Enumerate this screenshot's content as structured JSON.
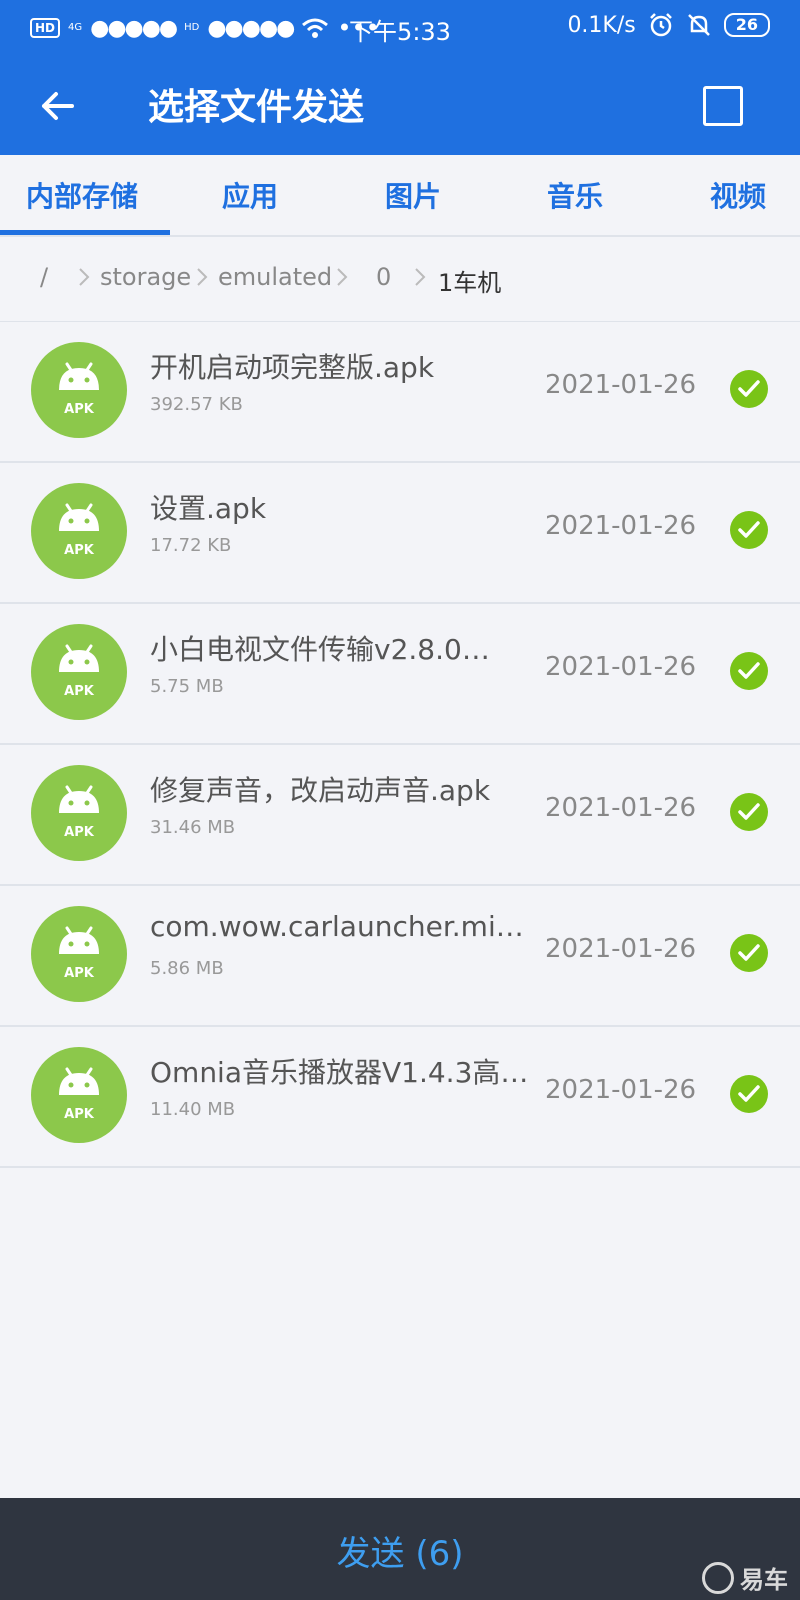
{
  "status_bar": {
    "hd1": "HD",
    "signal1": "4G",
    "dots1": "●●●●●",
    "hd2": "HD",
    "dots2": "●●●●●",
    "more": "•••",
    "time": "下午5:33",
    "net_speed": "0.1K/s",
    "battery": "26"
  },
  "appbar": {
    "title": "选择文件发送"
  },
  "tabs": [
    {
      "label": "内部存储",
      "active": true
    },
    {
      "label": "应用",
      "active": false
    },
    {
      "label": "图片",
      "active": false
    },
    {
      "label": "音乐",
      "active": false
    },
    {
      "label": "视频",
      "active": false
    }
  ],
  "breadcrumb": [
    "/",
    "storage",
    "emulated",
    "0",
    "1车机"
  ],
  "files": [
    {
      "name": "开机启动项完整版.apk",
      "size": "392.57 KB",
      "date": "2021-01-26",
      "icon_label": "APK"
    },
    {
      "name": "设置.apk",
      "size": "17.72 KB",
      "date": "2021-01-26",
      "icon_label": "APK"
    },
    {
      "name": "小白电视文件传输v2.8.0…",
      "size": "5.75 MB",
      "date": "2021-01-26",
      "icon_label": "APK"
    },
    {
      "name": "修复声音，改启动声音.apk",
      "size": "31.46 MB",
      "date": "2021-01-26",
      "icon_label": "APK"
    },
    {
      "name": "com.wow.carlauncher.mi…",
      "size": "5.86 MB",
      "date": "2021-01-26",
      "icon_label": "APK"
    },
    {
      "name": "Omnia音乐播放器V1.4.3高…",
      "size": "11.40 MB",
      "date": "2021-01-26",
      "icon_label": "APK"
    }
  ],
  "bottom": {
    "send_label": "发送 (6)",
    "watermark": "易车"
  },
  "colors": {
    "primary": "#1f70e0",
    "apk_icon": "#8cc84b",
    "check": "#79c417",
    "bottom_bar": "#2f3540",
    "send_text": "#3e9ef0"
  }
}
